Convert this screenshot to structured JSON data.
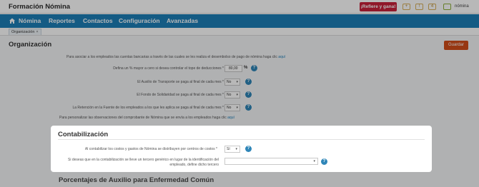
{
  "app": {
    "title": "Formación Nómina",
    "refer_button": "¡Refiere y gana!",
    "top_icons": [
      {
        "name": "add-icon",
        "glyph": "+"
      },
      {
        "name": "notifications-icon",
        "glyph": "!"
      },
      {
        "name": "badge-icon",
        "glyph": "4"
      }
    ],
    "user_name": "nómina"
  },
  "nav": {
    "items": [
      "Nómina",
      "Reportes",
      "Contactos",
      "Configuración",
      "Avanzadas"
    ]
  },
  "tabs": [
    {
      "label": "Organización",
      "close": "×"
    }
  ],
  "page": {
    "title": "Organización",
    "save_label": "Guardar"
  },
  "info": {
    "bank_text": "Para asociar a los empleados las cuentas bancarias a través de las cuales se les realiza el desembolso de pago de nómina haga clic",
    "bank_link": "aquí",
    "observ_text": "Para personalizar las observaciones del comprobante de Nómina que se envía a los empleados haga clic",
    "observ_link": "aquí"
  },
  "settings": {
    "deduction_label": "Defina un % mayor a cero si desea controlar el tope de deducciones *",
    "deduction_value": "80,00",
    "deduction_unit": "%",
    "transport_label": "El Auxilio de Transporte se paga al final de cada mes *",
    "transport_value": "No",
    "solidarity_label": "El Fondo de Solidaridad se paga al final de cada mes *",
    "solidarity_value": "No",
    "retention_label": "La Retención en la Fuente de los empleados a los que les aplica se paga al final de cada mes *",
    "retention_value": "No"
  },
  "contabilizacion": {
    "title": "Contabilización",
    "cost_center_label": "Al contabilizar los costos y gastos de Nómina se distribuyen por centros de costos *",
    "cost_center_value": "Sí",
    "third_party_label_1": "Si deseas que en la contabilización se lleve un tercero genérico en lugar de la identificación del",
    "third_party_label_2": "empleado, define dicho tercero",
    "third_party_value": ""
  },
  "next_section": {
    "title": "Porcentajes de Auxilio para Enfermedad Común"
  },
  "help_glyph": "?",
  "caret_glyph": "▾",
  "colors": {
    "nav": "#1d7fb8",
    "refer": "#c8203a",
    "save": "#d24d1a",
    "help": "#2f86b8"
  }
}
